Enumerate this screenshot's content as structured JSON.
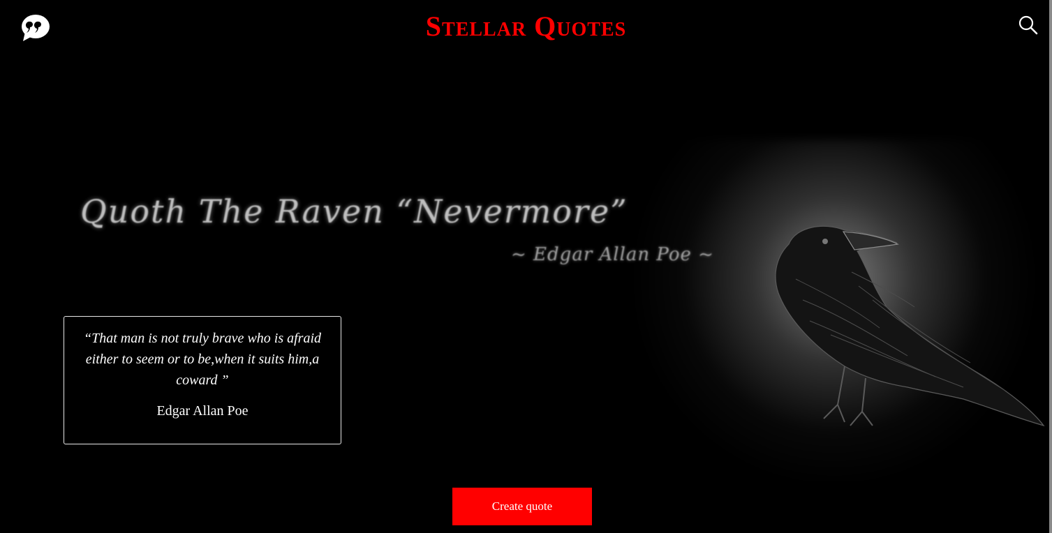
{
  "colors": {
    "accent": "#ff0000",
    "background": "#000000",
    "text": "#ffffff",
    "card_border": "#e8e8e8"
  },
  "header": {
    "logo_icon": "quote-bubble-icon",
    "title": "Stellar Quotes",
    "search_icon": "search-icon"
  },
  "hero": {
    "script_text": "Quoth The Raven “Nevermore”",
    "script_attribution": "~ Edgar Allan Poe ~",
    "image": "raven-illustration"
  },
  "quote_card": {
    "text": "“That man is not truly brave who is afraid either to seem or to be,when it suits him,a coward ”",
    "author": "Edgar Allan Poe"
  },
  "actions": {
    "create_label": "Create quote"
  }
}
